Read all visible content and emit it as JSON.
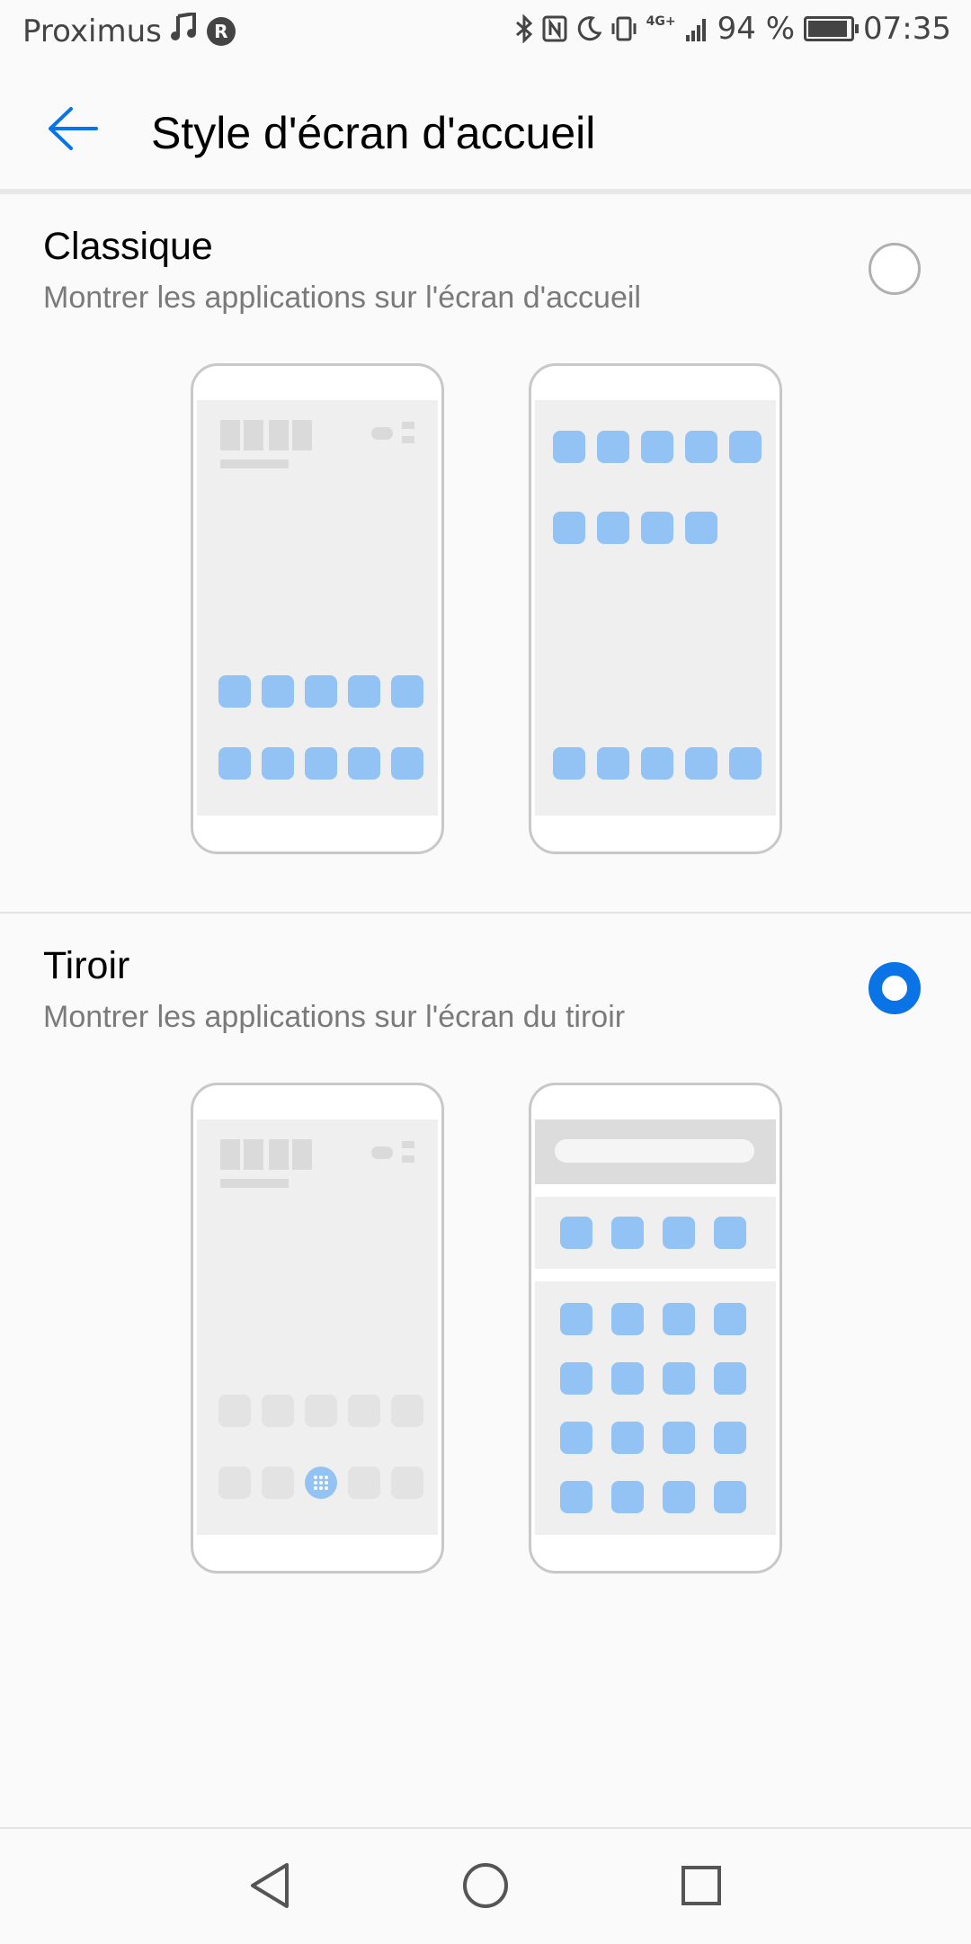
{
  "status_bar": {
    "carrier": "Proximus",
    "music_icon": "music-note-icon",
    "roaming_badge": "R",
    "network": "4G+",
    "battery_percent": "94 %",
    "battery_level": 0.94,
    "time": "07:35",
    "icons": [
      "bluetooth-icon",
      "nfc-icon",
      "do-not-disturb-moon-icon",
      "vibrate-icon",
      "signal-icon",
      "battery-icon"
    ]
  },
  "app_bar": {
    "back_icon": "arrow-left-icon",
    "title": "Style d'écran d'accueil"
  },
  "options": [
    {
      "title": "Classique",
      "description": "Montrer les applications sur l'écran d'accueil",
      "selected": false
    },
    {
      "title": "Tiroir",
      "description": "Montrer les applications sur l'écran du tiroir",
      "selected": true
    }
  ],
  "colors": {
    "accent": "#0a73e6",
    "app_icon": "#92c3f4",
    "screen_bg": "#efefef"
  },
  "nav_bar": {
    "icons": [
      "back-triangle-icon",
      "home-circle-icon",
      "recents-square-icon"
    ]
  }
}
